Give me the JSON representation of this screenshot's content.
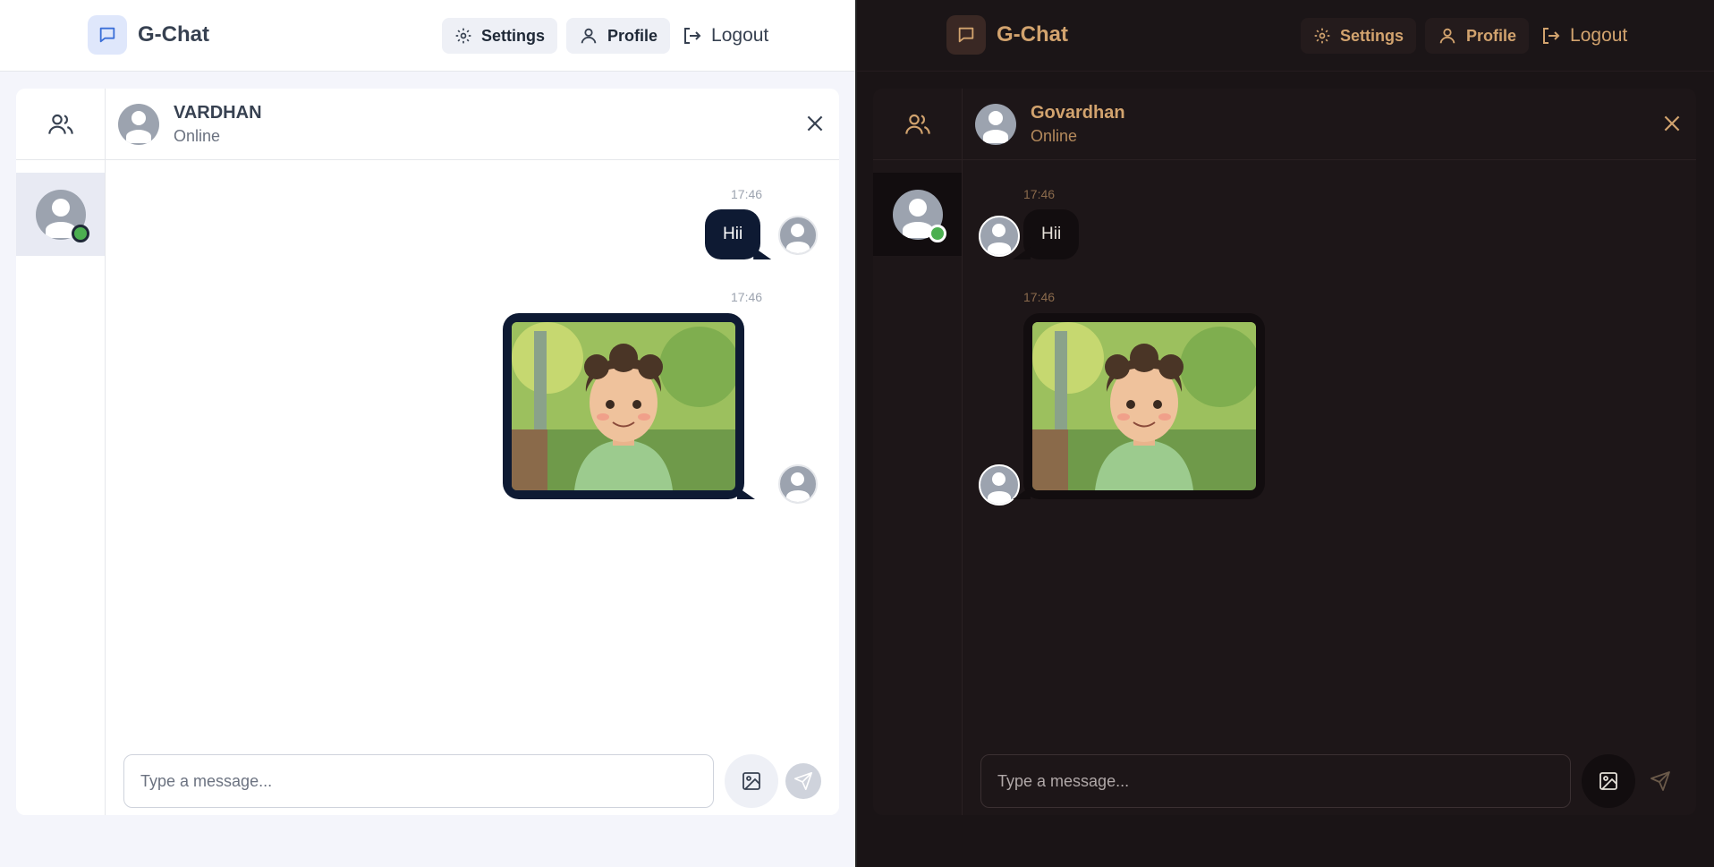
{
  "light": {
    "brand": "G-Chat",
    "nav": {
      "settings": "Settings",
      "profile": "Profile",
      "logout": "Logout"
    },
    "chat": {
      "name": "VARDHAN",
      "status": "Online"
    },
    "messages": [
      {
        "time": "17:46",
        "text": "Hii"
      },
      {
        "time": "17:46",
        "image": "boy-portrait"
      }
    ],
    "composer": {
      "placeholder": "Type a message..."
    }
  },
  "dark": {
    "brand": "G-Chat",
    "nav": {
      "settings": "Settings",
      "profile": "Profile",
      "logout": "Logout"
    },
    "chat": {
      "name": "Govardhan",
      "status": "Online"
    },
    "messages": [
      {
        "time": "17:46",
        "text": "Hii"
      },
      {
        "time": "17:46",
        "image": "boy-portrait"
      }
    ],
    "composer": {
      "placeholder": "Type a message..."
    }
  },
  "icons": {
    "brand": "chat-bubble-icon",
    "settings": "gear-icon",
    "profile": "user-icon",
    "logout": "logout-icon",
    "contacts": "users-icon",
    "close": "close-icon",
    "image": "image-icon",
    "send": "send-icon"
  },
  "colors": {
    "light_bubble": "#0e1a33",
    "light_accent": "#3b6fd8",
    "dark_accent": "#d2a36e",
    "online": "#4caf50"
  }
}
